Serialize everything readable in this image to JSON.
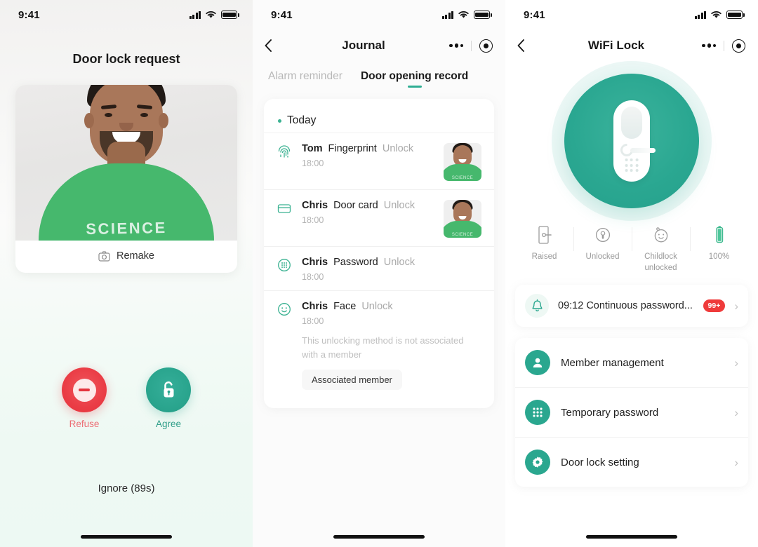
{
  "status_bar": {
    "time": "9:41",
    "signal_icon": "cellular-signal-icon",
    "wifi_icon": "wifi-icon",
    "battery_icon": "battery-full-icon"
  },
  "screen1": {
    "name": "door-lock-request",
    "title": "Door lock request",
    "photo": {
      "alt": "visitor-photo",
      "shirt_text": "SCIENCE"
    },
    "remake": {
      "label": "Remake",
      "icon": "camera-icon"
    },
    "actions": [
      {
        "key": "refuse",
        "label": "Refuse",
        "icon": "minus-circle-icon",
        "color": "#e4343e"
      },
      {
        "key": "agree",
        "label": "Agree",
        "icon": "unlock-icon",
        "color": "#2aa58e"
      }
    ],
    "ignore_label": "Ignore (89s)"
  },
  "screen2": {
    "name": "journal",
    "nav": {
      "title": "Journal",
      "back_icon": "chevron-left-icon",
      "more_icon": "more-dots-icon",
      "scan_icon": "target-icon"
    },
    "tabs": [
      {
        "label": "Alarm reminder",
        "active": false
      },
      {
        "label": "Door opening record",
        "active": true
      }
    ],
    "group_label": "Today",
    "entries": [
      {
        "user": "Tom",
        "method": "Fingerprint",
        "action": "Unlock",
        "time": "18:00",
        "icon": "fingerprint-icon",
        "thumb": true,
        "note": "",
        "assoc_button": ""
      },
      {
        "user": "Chris",
        "method": "Door card",
        "action": "Unlock",
        "time": "18:00",
        "icon": "card-icon",
        "thumb": true,
        "note": "",
        "assoc_button": ""
      },
      {
        "user": "Chris",
        "method": "Password",
        "action": "Unlock",
        "time": "18:00",
        "icon": "keypad-icon",
        "thumb": false,
        "note": "",
        "assoc_button": ""
      },
      {
        "user": "Chris",
        "method": "Face",
        "action": "Unlock",
        "time": "18:00",
        "icon": "face-icon",
        "thumb": false,
        "note": "This unlocking method is not associated with a member",
        "assoc_button": "Associated member"
      }
    ]
  },
  "screen3": {
    "name": "wifi-lock",
    "nav": {
      "title": "WiFi Lock",
      "back_icon": "chevron-left-icon",
      "more_icon": "more-dots-icon",
      "scan_icon": "target-icon"
    },
    "hero": {
      "icon": "smart-door-lock-icon",
      "color": "#2aa791"
    },
    "status": [
      {
        "label": "Raised",
        "icon": "door-handle-icon"
      },
      {
        "label": "Unlocked",
        "icon": "lock-open-icon"
      },
      {
        "label": "Childlock unlocked",
        "icon": "child-face-icon"
      },
      {
        "label": "100%",
        "icon": "battery-icon"
      }
    ],
    "alert": {
      "icon": "bell-icon",
      "text": "09:12 Continuous password...",
      "badge": "99+",
      "chevron": "›"
    },
    "menu": [
      {
        "label": "Member management",
        "icon": "person-icon",
        "chevron": "›"
      },
      {
        "label": "Temporary password",
        "icon": "keypad-grid-icon",
        "chevron": "›"
      },
      {
        "label": "Door lock setting",
        "icon": "gear-icon",
        "chevron": "›"
      }
    ]
  }
}
